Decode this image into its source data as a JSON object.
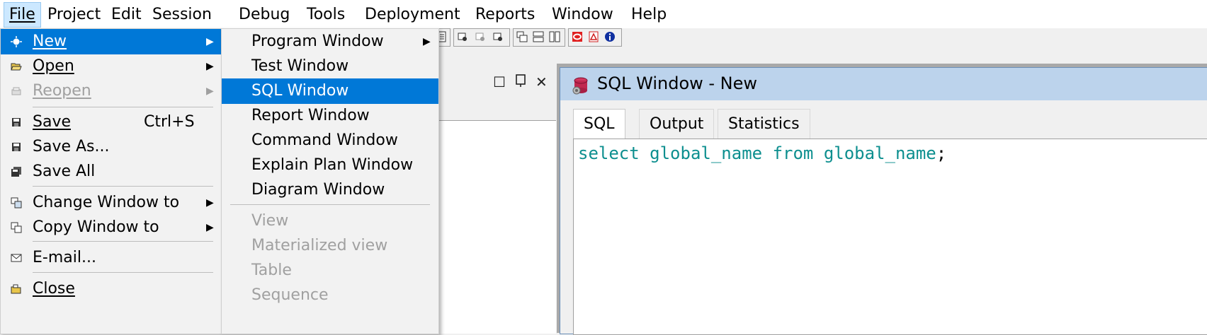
{
  "menubar": {
    "items": [
      {
        "label": "File"
      },
      {
        "label": "Project"
      },
      {
        "label": "Edit"
      },
      {
        "label": "Session"
      },
      {
        "label": "Debug"
      },
      {
        "label": "Tools"
      },
      {
        "label": "Deployment"
      },
      {
        "label": "Reports"
      },
      {
        "label": "Window"
      },
      {
        "label": "Help"
      }
    ]
  },
  "file_menu": {
    "new": "New",
    "open": "Open",
    "reopen": "Reopen",
    "save": "Save",
    "save_shortcut": "Ctrl+S",
    "save_as": "Save As...",
    "save_all": "Save All",
    "change_window_to": "Change Window to",
    "copy_window_to": "Copy Window to",
    "email": "E-mail...",
    "close": "Close"
  },
  "new_submenu": {
    "program_window": "Program Window",
    "test_window": "Test Window",
    "sql_window": "SQL Window",
    "report_window": "Report Window",
    "command_window": "Command Window",
    "explain_plan_window": "Explain Plan Window",
    "diagram_window": "Diagram Window",
    "view": "View",
    "materialized_view": "Materialized view",
    "table": "Table",
    "sequence": "Sequence"
  },
  "sql_window": {
    "title": "SQL Window - New",
    "tabs": [
      {
        "label": "SQL"
      },
      {
        "label": "Output"
      },
      {
        "label": "Statistics"
      }
    ],
    "code_keyword1": "select",
    "code_ident1": "global_name",
    "code_keyword2": "from",
    "code_ident2": "global_name",
    "code_terminator": ";"
  },
  "colors": {
    "highlight": "#0078d7",
    "code_text": "#0d8f8f",
    "title_bar": "#bcd3ec"
  }
}
